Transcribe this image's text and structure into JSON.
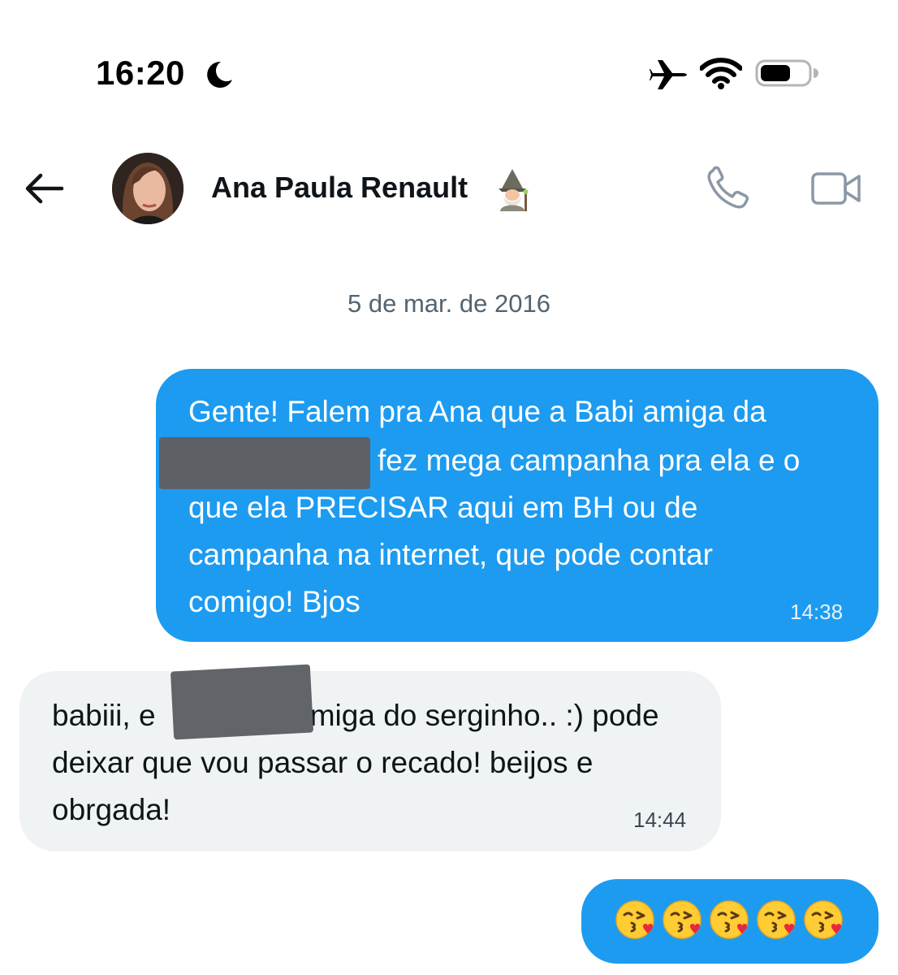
{
  "status_bar": {
    "time": "16:20"
  },
  "header": {
    "contact_name": "Ana Paula Renault",
    "name_emoji": "mage-icon"
  },
  "date_separator": "5 de mar. de 2016",
  "messages": [
    {
      "direction": "out",
      "lines": [
        "Gente! Falem pra Ana que a Babi amiga da",
        "fez mega campanha pra ela e o",
        "que ela PRECISAR aqui em BH ou de",
        "campanha na internet, que pode contar",
        "comigo! Bjos"
      ],
      "time": "14:38"
    },
    {
      "direction": "in",
      "lines": [
        "babiii, e",
        "n, amiga do serginho.. :) pode",
        "deixar que vou passar o recado! beijos e",
        "obrgada!"
      ],
      "time": "14:44"
    },
    {
      "direction": "out",
      "emojis": [
        "kiss-emoji",
        "kiss-emoji",
        "kiss-emoji",
        "kiss-emoji",
        "kiss-emoji"
      ]
    }
  ],
  "colors": {
    "outgoing_bubble": "#1d9bf0",
    "incoming_bubble": "#eff3f4",
    "muted_text": "#536471"
  }
}
